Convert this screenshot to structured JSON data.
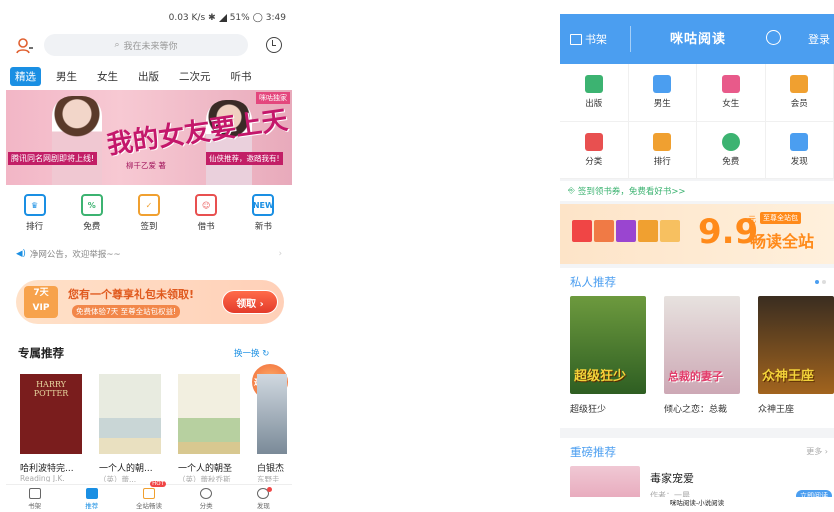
{
  "left": {
    "status": {
      "speed": "0.03 K/s",
      "battery": "51%",
      "time": "3:49"
    },
    "search": {
      "placeholder": "我在未来等你"
    },
    "tabs": [
      "精选",
      "男生",
      "女生",
      "出版",
      "二次元",
      "听书"
    ],
    "banner": {
      "title": "我的女友要上天",
      "tag": "咪咕独家",
      "sub1": "腾讯同名网剧即将上线!",
      "sub2": "柳千乙爱 著",
      "sub3": "仙侠推荐，邀踏我有!"
    },
    "quick": [
      {
        "icon": "trophy-icon",
        "label": "排行",
        "glyph": "🏆"
      },
      {
        "icon": "free-icon",
        "label": "免费",
        "glyph": "%"
      },
      {
        "icon": "checkin-icon",
        "label": "签到",
        "glyph": "✓"
      },
      {
        "icon": "borrow-icon",
        "label": "借书",
        "glyph": "☺"
      },
      {
        "icon": "new-book-icon",
        "label": "新书",
        "glyph": "NEW"
      }
    ],
    "notice": "净网公告，欢迎举报~~",
    "vip": {
      "badge_days": "7天",
      "badge_vip": "VIP",
      "msg1": "您有一个尊享礼包未领取!",
      "msg2": "免费体验7天 至尊全站包权益!",
      "button": "领取 ›"
    },
    "section_title": "专属推荐",
    "change_label": "换一换 ↻",
    "float_badge": "邀请有礼",
    "books": [
      {
        "title": "哈利波特完...",
        "sub": "Reading J.K.",
        "cover_text": "HARRY POTTER"
      },
      {
        "title": "一个人的朝...",
        "sub": "（英）蕾...",
        "cover_text": ""
      },
      {
        "title": "一个人的朝圣",
        "sub": "（英）蕾秋乔斯",
        "cover_text": ""
      },
      {
        "title": "白银杰",
        "sub": "东野圭",
        "cover_text": ""
      }
    ],
    "nav": [
      {
        "label": "书架",
        "icon": "bookshelf-icon",
        "active": false
      },
      {
        "label": "推荐",
        "icon": "recommend-icon",
        "active": true
      },
      {
        "label": "全站畅读",
        "icon": "vip-read-icon",
        "active": false,
        "hot": "HOT"
      },
      {
        "label": "分类",
        "icon": "category-icon",
        "active": false
      },
      {
        "label": "发现",
        "icon": "discover-icon",
        "active": false
      }
    ]
  },
  "right": {
    "header": {
      "shelf": "书架",
      "logo": "咪咕阅读",
      "login": "登录"
    },
    "grid": [
      {
        "label": "出版",
        "icon": "publish-icon",
        "color": "#3cb371"
      },
      {
        "label": "男生",
        "icon": "male-icon",
        "color": "#4b9ef0"
      },
      {
        "label": "女生",
        "icon": "female-icon",
        "color": "#e85a8a"
      },
      {
        "label": "会员",
        "icon": "vip-member-icon",
        "color": "#f0a030"
      },
      {
        "label": "分类",
        "icon": "category-icon",
        "color": "#e85050"
      },
      {
        "label": "排行",
        "icon": "rank-icon",
        "color": "#f0a030"
      },
      {
        "label": "免费",
        "icon": "free-icon",
        "color": "#3cb371"
      },
      {
        "label": "发现",
        "icon": "discover-icon",
        "color": "#4b9ef0"
      }
    ],
    "promo": "签到领书券，免费看好书>>",
    "banner": {
      "price": "9.9",
      "yuan": "元",
      "tag": "至尊全站包",
      "label": "畅读全站"
    },
    "private_title": "私人推荐",
    "private_books": [
      {
        "title": "超级狂少",
        "cover_text": "超级狂少"
      },
      {
        "title": "倾心之恋：总裁",
        "cover_text": "总裁的妻子"
      },
      {
        "title": "众神王座",
        "cover_text": "众神王座"
      }
    ],
    "heavy_title": "重磅推荐",
    "heavy_more": "更多 ›",
    "heavy_book": {
      "title": "毒家宠爱",
      "sub": "作者：一晨",
      "button": "立即阅读"
    },
    "caption": "咪咕阅读-小说阅读"
  }
}
